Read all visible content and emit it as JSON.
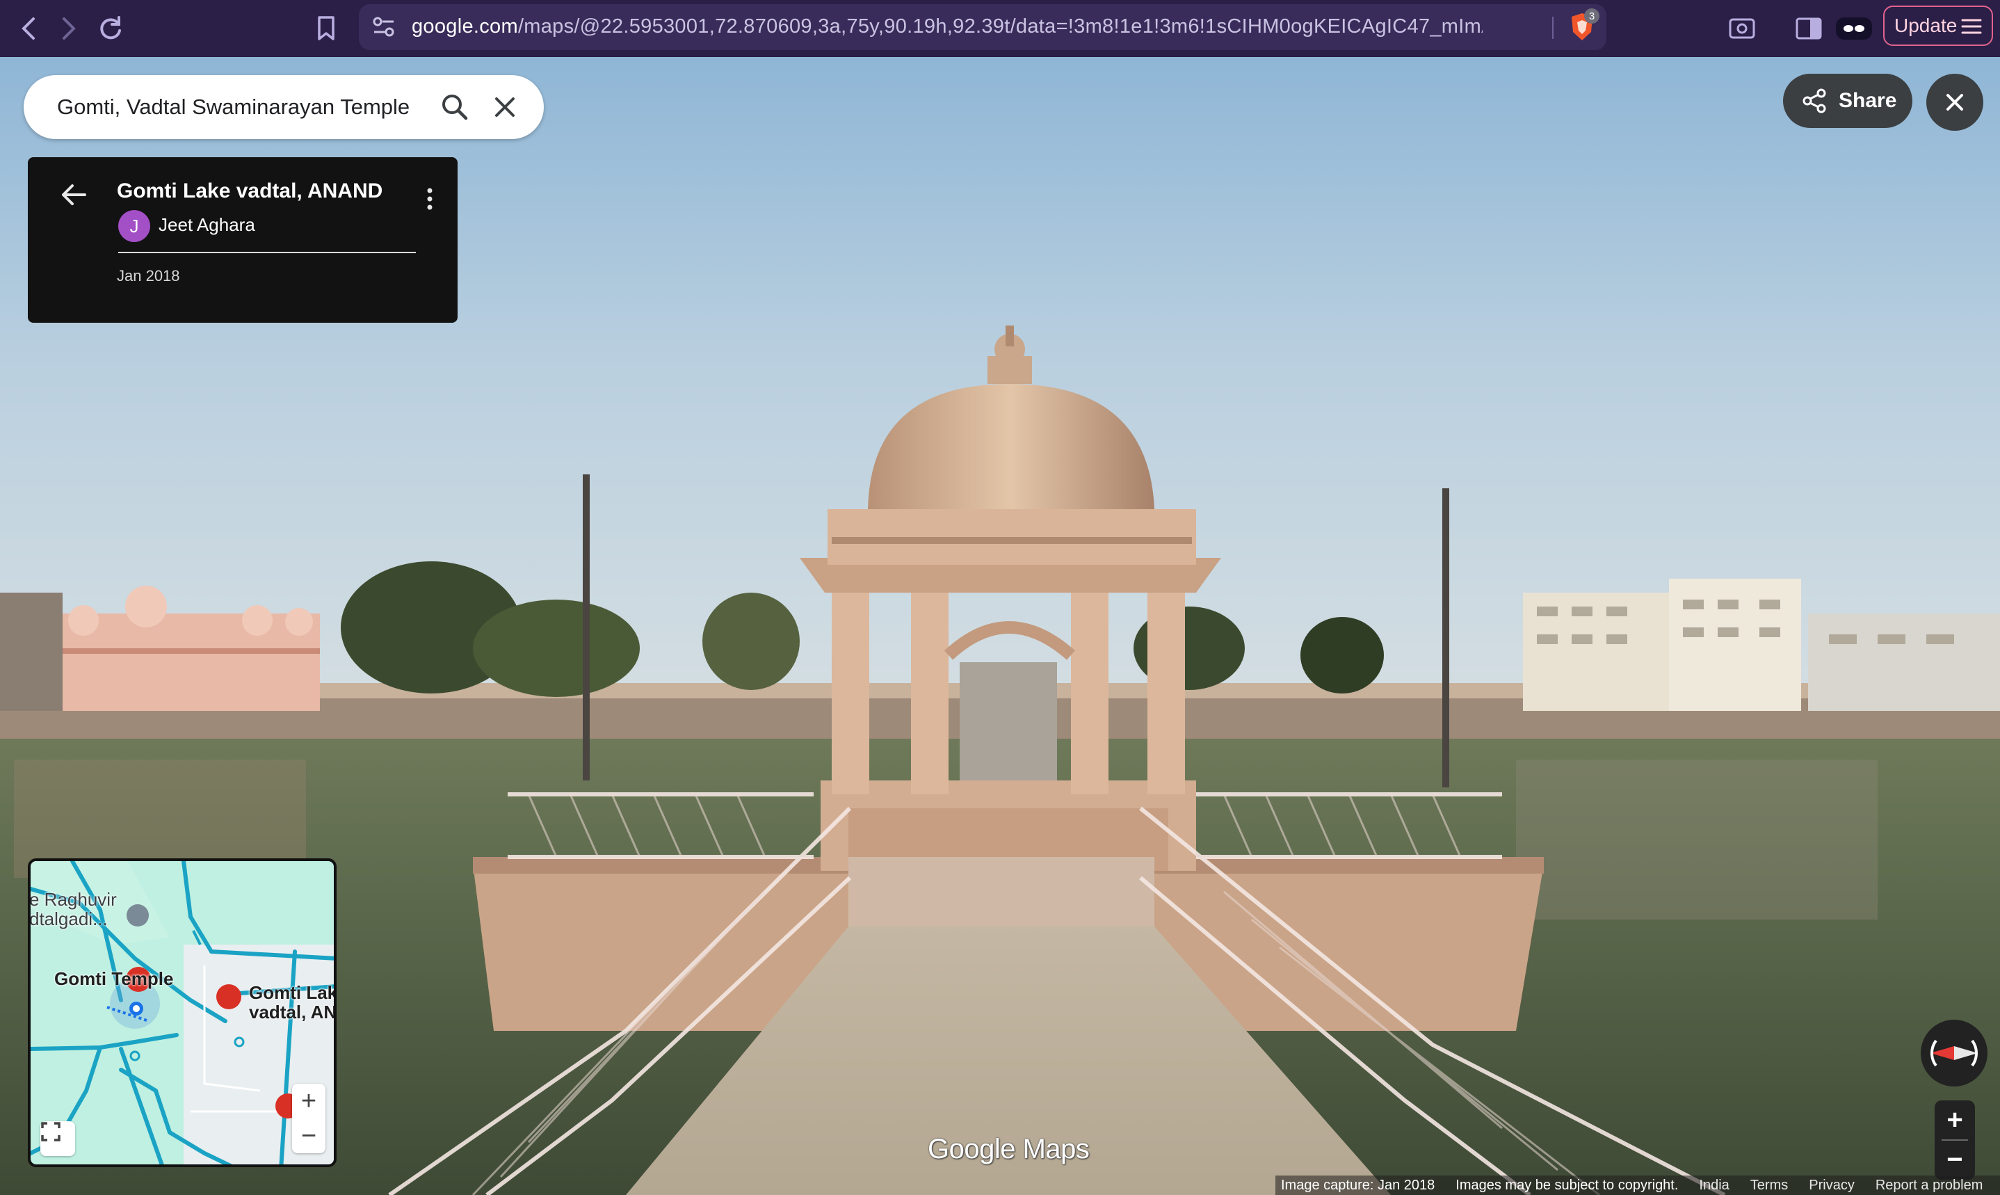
{
  "browser": {
    "url_host": "google.com",
    "url_path": "/maps/@22.5953001,72.870609,3a,75y,90.19h,92.39t/data=!3m8!1e1!3m6!1sCIHM0ogKEICAgIC47_mImAE!...",
    "brave_shield_count": "3",
    "update_label": "Update"
  },
  "search": {
    "value": "Gomti, Vadtal Swaminarayan Temple"
  },
  "info_card": {
    "title": "Gomti Lake vadtal, ANAND",
    "avatar_initial": "J",
    "author": "Jeet Aghara",
    "date": "Jan 2018"
  },
  "share_label": "Share",
  "minimap": {
    "labels": {
      "raghuvir_line1": "e Raghuvir",
      "raghuvir_line2": "dtalgadi...",
      "gomti_temple": "Gomti Temple",
      "gomti_lake_line1": "Gomti Lak",
      "gomti_lake_line2": "vadtal, AN"
    },
    "zoom_in": "+",
    "zoom_out": "−"
  },
  "sv_zoom": {
    "in": "+",
    "out": "−"
  },
  "logo": "Google Maps",
  "footer": {
    "capture": "Image capture: Jan 2018",
    "copyright": "Images may be subject to copyright.",
    "country": "India",
    "terms": "Terms",
    "privacy": "Privacy",
    "report": "Report a problem"
  },
  "colors": {
    "browser_bar": "#2b1f47",
    "url_bar": "#3a2c5a",
    "update_border": "#e0638e",
    "card_bg": "#121212",
    "avatar": "#a34fc6",
    "map_water": "#bff0e1",
    "map_road": "#1aa3c4"
  }
}
